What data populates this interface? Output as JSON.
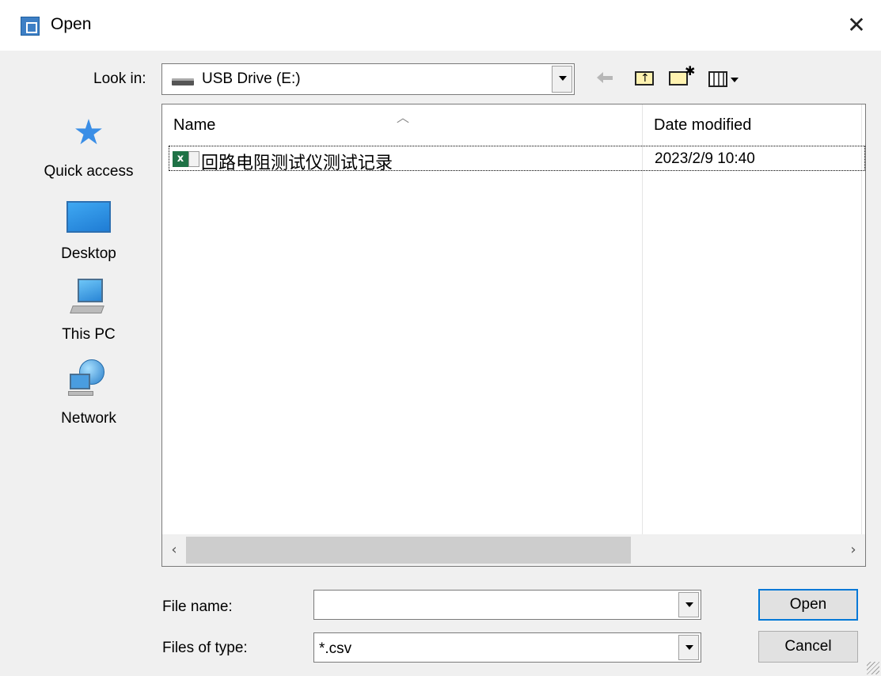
{
  "window": {
    "title": "Open",
    "close_glyph": "✕"
  },
  "toolbar": {
    "look_in_label": "Look in:",
    "look_in_value": "USB Drive (E:)",
    "buttons": [
      "back-arrow-icon",
      "up-one-level-icon",
      "new-folder-icon",
      "view-menu-icon"
    ]
  },
  "places": [
    {
      "label": "Quick access",
      "icon": "star-icon"
    },
    {
      "label": "Desktop",
      "icon": "desktop-icon"
    },
    {
      "label": "This PC",
      "icon": "computer-icon"
    },
    {
      "label": "Network",
      "icon": "network-icon"
    }
  ],
  "file_list": {
    "columns": [
      "Name",
      "Date modified"
    ],
    "rows": [
      {
        "name": "回路电阻测试仪测试记录",
        "date_modified": "2023/2/9 10:40",
        "icon": "excel-csv-file-icon"
      }
    ]
  },
  "form": {
    "file_name_label": "File name:",
    "file_name_value": "",
    "files_of_type_label": "Files of type:",
    "files_of_type_value": "*.csv"
  },
  "buttons": {
    "open": "Open",
    "cancel": "Cancel"
  },
  "colors": {
    "dialog_bg": "#f0f0f0",
    "focus_border": "#0078d7",
    "excel_green": "#1f7246"
  }
}
